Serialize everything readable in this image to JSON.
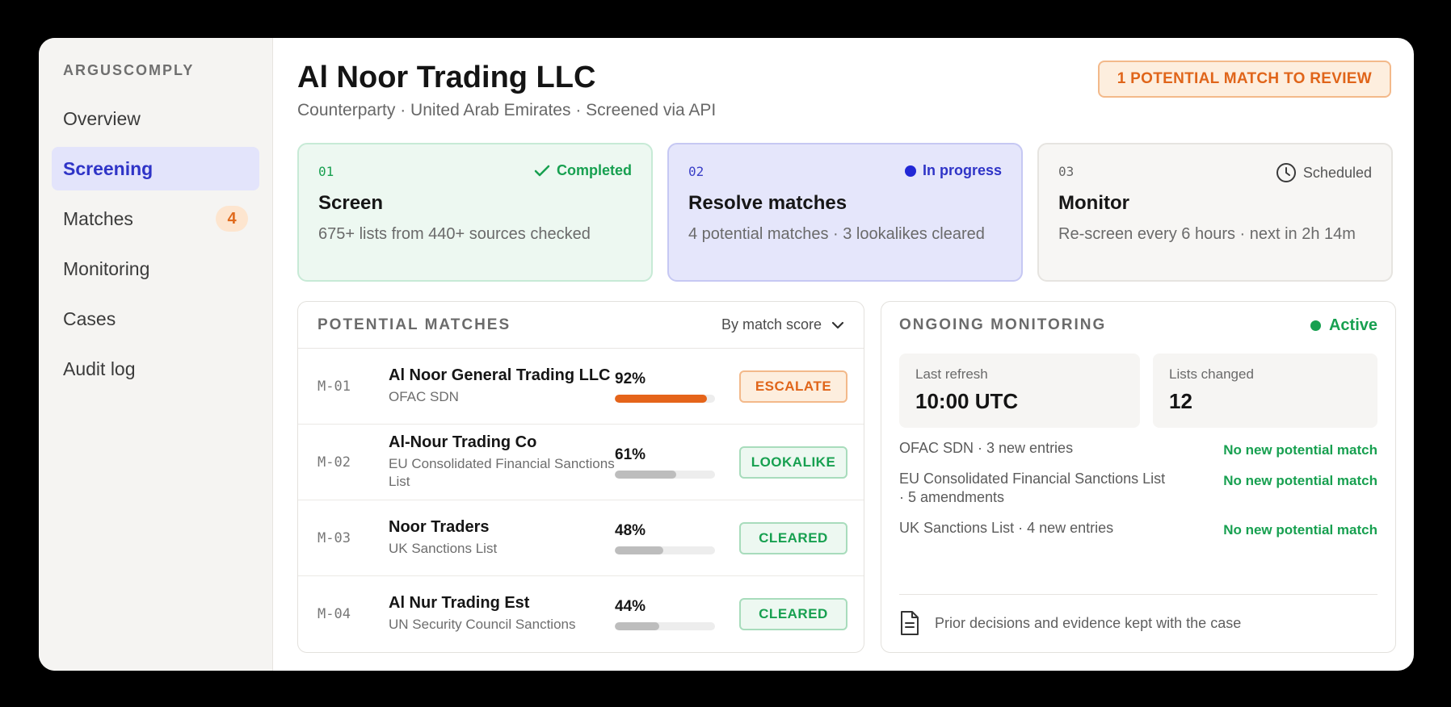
{
  "app": {
    "brand": "ARGUSCOMPLY"
  },
  "sidebar": {
    "items": [
      {
        "label": "Overview"
      },
      {
        "label": "Screening"
      },
      {
        "label": "Matches",
        "badge": "4"
      },
      {
        "label": "Monitoring"
      },
      {
        "label": "Cases"
      },
      {
        "label": "Audit log"
      }
    ]
  },
  "header": {
    "title": "Al Noor Trading LLC",
    "subtitle": "Counterparty · United Arab Emirates · Screened via API",
    "review_label": "1 POTENTIAL MATCH TO REVIEW"
  },
  "steps": [
    {
      "num": "01",
      "status": "Completed",
      "title": "Screen",
      "desc": "675+ lists from 440+ sources checked"
    },
    {
      "num": "02",
      "status": "In progress",
      "title": "Resolve matches",
      "desc": "4 potential matches · 3 lookalikes cleared"
    },
    {
      "num": "03",
      "status": "Scheduled",
      "title": "Monitor",
      "desc": "Re-screen every 6 hours · next in 2h 14m"
    }
  ],
  "matches": {
    "title": "POTENTIAL MATCHES",
    "sort_label": "By match score",
    "rows": [
      {
        "id": "M-01",
        "name": "Al Noor General Trading LLC",
        "list": "OFAC SDN",
        "score": "92%",
        "score_value": 92,
        "action": "ESCALATE"
      },
      {
        "id": "M-02",
        "name": "Al-Nour Trading Co",
        "list": "EU Consolidated Financial Sanctions List",
        "score": "61%",
        "score_value": 61,
        "action": "LOOKALIKE"
      },
      {
        "id": "M-03",
        "name": "Noor Traders",
        "list": "UK Sanctions List",
        "score": "48%",
        "score_value": 48,
        "action": "CLEARED"
      },
      {
        "id": "M-04",
        "name": "Al Nur Trading Est",
        "list": "UN Security Council Sanctions",
        "score": "44%",
        "score_value": 44,
        "action": "CLEARED"
      }
    ]
  },
  "monitoring": {
    "title": "ONGOING MONITORING",
    "status": "Active",
    "last_refresh_label": "Last refresh",
    "last_refresh_value": "10:00 UTC",
    "lists_changed_label": "Lists changed",
    "lists_changed_value": "12",
    "updates": [
      {
        "label": "OFAC SDN · 3 new entries",
        "result": "No new potential match"
      },
      {
        "label": "EU Consolidated Financial Sanctions List · 5 amendments",
        "result": "No new potential match"
      },
      {
        "label": "UK Sanctions List · 4 new entries",
        "result": "No new potential match"
      }
    ],
    "footnote": "Prior decisions and evidence kept with the case"
  },
  "colors": {
    "accent": "#2f34c7",
    "warning": "#e0651a",
    "success": "#17a050"
  }
}
